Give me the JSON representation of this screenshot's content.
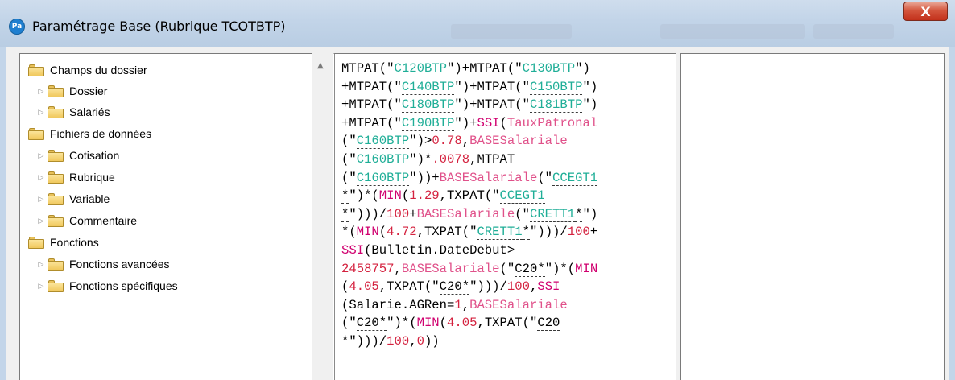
{
  "window": {
    "title": "Paramétrage Base (Rubrique TCOTBTP)",
    "app_icon_text": "Pa",
    "close_label": "X"
  },
  "tree": {
    "items": [
      {
        "label": "Champs du dossier",
        "level": 0,
        "expandable": false
      },
      {
        "label": "Dossier",
        "level": 1,
        "expandable": true
      },
      {
        "label": "Salariés",
        "level": 1,
        "expandable": true
      },
      {
        "label": "Fichiers de données",
        "level": 0,
        "expandable": false
      },
      {
        "label": "Cotisation",
        "level": 1,
        "expandable": true
      },
      {
        "label": "Rubrique",
        "level": 1,
        "expandable": true
      },
      {
        "label": "Variable",
        "level": 1,
        "expandable": true
      },
      {
        "label": "Commentaire",
        "level": 1,
        "expandable": true
      },
      {
        "label": "Fonctions",
        "level": 0,
        "expandable": false
      },
      {
        "label": "Fonctions avancées",
        "level": 1,
        "expandable": true
      },
      {
        "label": "Fonctions spécifiques",
        "level": 1,
        "expandable": true
      }
    ]
  },
  "formula": {
    "lines": [
      [
        [
          "f",
          "MTPAT(\""
        ],
        [
          "s",
          "C120BTP"
        ],
        [
          "f",
          "\")+MTPAT(\""
        ],
        [
          "s",
          "C130BTP"
        ],
        [
          "f",
          "\")"
        ]
      ],
      [
        [
          "f",
          "+MTPAT(\""
        ],
        [
          "s",
          "C140BTP"
        ],
        [
          "f",
          "\")+MTPAT(\""
        ],
        [
          "s",
          "C150BTP"
        ],
        [
          "f",
          "\")"
        ]
      ],
      [
        [
          "f",
          "+MTPAT(\""
        ],
        [
          "s",
          "C180BTP"
        ],
        [
          "f",
          "\")+MTPAT(\""
        ],
        [
          "s",
          "C181BTP"
        ],
        [
          "f",
          "\")"
        ]
      ],
      [
        [
          "f",
          "+MTPAT(\""
        ],
        [
          "s",
          "C190BTP"
        ],
        [
          "f",
          "\")+"
        ],
        [
          "k",
          "SSI"
        ],
        [
          "f",
          "("
        ],
        [
          "v",
          "TauxPatronal"
        ]
      ],
      [
        [
          "f",
          "(\""
        ],
        [
          "s",
          "C160BTP"
        ],
        [
          "f",
          "\")>"
        ],
        [
          "n",
          "0.78"
        ],
        [
          "f",
          ","
        ],
        [
          "v",
          "BASESalariale"
        ]
      ],
      [
        [
          "f",
          "(\""
        ],
        [
          "s",
          "C160BTP"
        ],
        [
          "f",
          "\")*"
        ],
        [
          "n",
          ".0078"
        ],
        [
          "f",
          ",MTPAT"
        ]
      ],
      [
        [
          "f",
          "(\""
        ],
        [
          "s",
          "C160BTP"
        ],
        [
          "f",
          "\"))+"
        ],
        [
          "v",
          "BASESalariale"
        ],
        [
          "f",
          "(\""
        ],
        [
          "s",
          "CCEGT1"
        ]
      ],
      [
        [
          "sb",
          "*"
        ],
        [
          "f",
          "\")*("
        ],
        [
          "k",
          "MIN"
        ],
        [
          "f",
          "("
        ],
        [
          "n",
          "1.29"
        ],
        [
          "f",
          ",TXPAT(\""
        ],
        [
          "s",
          "CCEGT1"
        ]
      ],
      [
        [
          "sb",
          "*"
        ],
        [
          "f",
          "\")))/"
        ],
        [
          "n",
          "100"
        ],
        [
          "f",
          "+"
        ],
        [
          "v",
          "BASESalariale"
        ],
        [
          "f",
          "(\""
        ],
        [
          "s",
          "CRETT1"
        ],
        [
          "sb",
          "*"
        ],
        [
          "f",
          "\")"
        ]
      ],
      [
        [
          "f",
          "*("
        ],
        [
          "k",
          "MIN"
        ],
        [
          "f",
          "("
        ],
        [
          "n",
          "4.72"
        ],
        [
          "f",
          ",TXPAT(\""
        ],
        [
          "s",
          "CRETT1"
        ],
        [
          "sb",
          "*"
        ],
        [
          "f",
          "\")))/"
        ],
        [
          "n",
          "100"
        ],
        [
          "f",
          "+"
        ]
      ],
      [
        [
          "k",
          "SSI"
        ],
        [
          "f",
          "(Bulletin.DateDebut>"
        ]
      ],
      [
        [
          "n",
          "2458757"
        ],
        [
          "f",
          ","
        ],
        [
          "v",
          "BASESalariale"
        ],
        [
          "f",
          "(\""
        ],
        [
          "sb",
          "C20*"
        ],
        [
          "f",
          "\")*("
        ],
        [
          "k",
          "MIN"
        ]
      ],
      [
        [
          "f",
          "("
        ],
        [
          "n",
          "4.05"
        ],
        [
          "f",
          ",TXPAT(\""
        ],
        [
          "sb",
          "C20*"
        ],
        [
          "f",
          "\")))/"
        ],
        [
          "n",
          "100"
        ],
        [
          "f",
          ","
        ],
        [
          "k",
          "SSI"
        ]
      ],
      [
        [
          "f",
          "(Salarie.AGRen="
        ],
        [
          "n",
          "1"
        ],
        [
          "f",
          ","
        ],
        [
          "v",
          "BASESalariale"
        ]
      ],
      [
        [
          "f",
          "(\""
        ],
        [
          "sb",
          "C20*"
        ],
        [
          "f",
          "\")*("
        ],
        [
          "k",
          "MIN"
        ],
        [
          "f",
          "("
        ],
        [
          "n",
          "4.05"
        ],
        [
          "f",
          ",TXPAT(\""
        ],
        [
          "sb",
          "C20"
        ]
      ],
      [
        [
          "sb",
          "*"
        ],
        [
          "f",
          "\")))/"
        ],
        [
          "n",
          "100"
        ],
        [
          "f",
          ","
        ],
        [
          "n",
          "0"
        ],
        [
          "f",
          "))"
        ]
      ]
    ]
  },
  "colors": {
    "function": "#000000",
    "string_code": "#1fae97",
    "keyword": "#d0006f",
    "variable": "#e0518a",
    "number": "#d4223f"
  },
  "icons": {
    "folder": "folder-icon",
    "expander": "triangle-right-icon",
    "scroll_up": "scroll-up-arrow-icon"
  }
}
